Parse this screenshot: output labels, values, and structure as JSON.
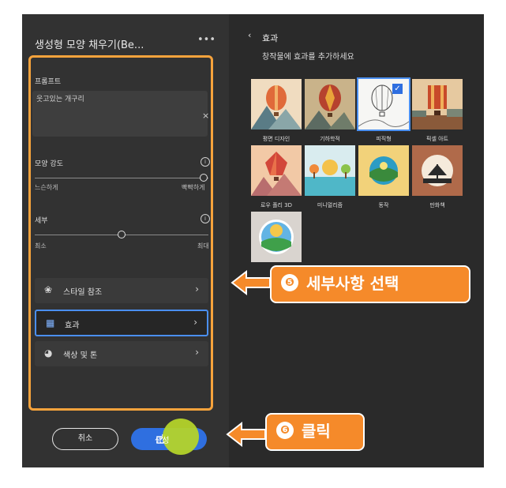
{
  "left_panel": {
    "title": "생성형 모양 채우기(Be...",
    "more_label": "•••",
    "prompt_label": "프롬프트",
    "prompt_value": "웃고있는 개구리",
    "prompt_clear": "×",
    "shape_strength_label": "모양 강도",
    "shape_strength_min": "느슨하게",
    "shape_strength_max": "빡빡하게",
    "shape_strength_level": 1.0,
    "detail_label": "세부",
    "detail_min": "최소",
    "detail_max": "최대",
    "detail_level": 0.5,
    "info_glyph": "i",
    "rows": [
      {
        "label": "스타일 참조",
        "icon": "style-reference-icon",
        "glyph": "❀",
        "chevron": "›"
      },
      {
        "label": "효과",
        "icon": "effects-icon",
        "glyph": "▦",
        "chevron": "›"
      },
      {
        "label": "색상 및 톤",
        "icon": "color-tone-icon",
        "glyph": "◕",
        "chevron": "›"
      }
    ],
    "cancel_label": "취소",
    "generate_label": "생성",
    "generate_icon": "export-icon"
  },
  "right_panel": {
    "back_glyph": "‹",
    "title": "효과",
    "subtitle": "창작물에 효과를 추가하세요",
    "effects": [
      {
        "label": "평면 디자인"
      },
      {
        "label": "기하학적"
      },
      {
        "label": "피직형",
        "selected": true
      },
      {
        "label": "픽셀 아트"
      },
      {
        "label": "로우 폴리 3D"
      },
      {
        "label": "미니멀리즘"
      },
      {
        "label": "동작"
      },
      {
        "label": "만화책"
      },
      {
        "label": ""
      }
    ],
    "check_glyph": "✓"
  },
  "callouts": {
    "step5_number": "❺",
    "step5_text": "세부사항 선택",
    "step6_number": "❻",
    "step6_text": "클릭"
  },
  "colors": {
    "accent_orange": "#f58a2a",
    "highlight_blue": "#2f6fe0",
    "click_highlight": "#b4d32a"
  }
}
